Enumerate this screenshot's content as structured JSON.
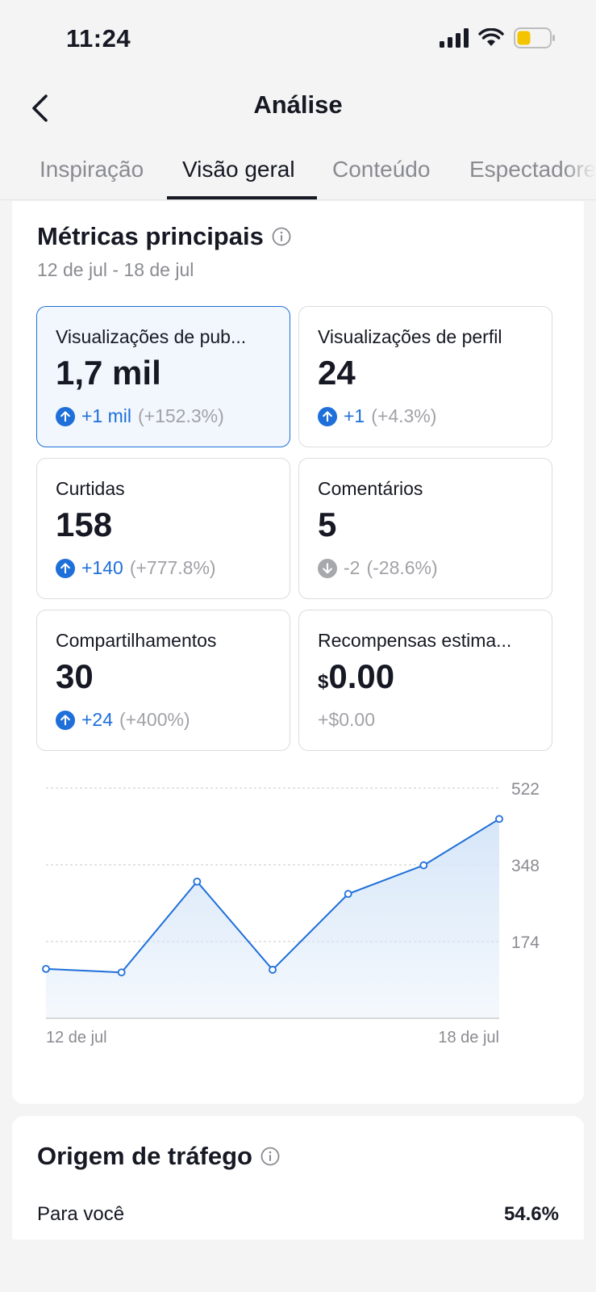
{
  "status_bar": {
    "time": "11:24",
    "icons": [
      "cellular-signal-icon",
      "wifi-icon",
      "battery-low-icon"
    ]
  },
  "header": {
    "title": "Análise",
    "back_icon": "chevron-left-icon"
  },
  "tabs": [
    {
      "label": "Inspiração",
      "active": false
    },
    {
      "label": "Visão geral",
      "active": true
    },
    {
      "label": "Conteúdo",
      "active": false
    },
    {
      "label": "Espectadores",
      "active": false
    }
  ],
  "metrics_section": {
    "title": "Métricas principais",
    "date_range": "12 de jul - 18 de jul",
    "cards": [
      {
        "label": "Visualizações de pub...",
        "value": "1,7 mil",
        "change_abs": "+1 mil",
        "change_pct": "(+152.3%)",
        "trend": "up",
        "selected": true
      },
      {
        "label": "Visualizações de perfil",
        "value": "24",
        "change_abs": "+1",
        "change_pct": "(+4.3%)",
        "trend": "up",
        "selected": false
      },
      {
        "label": "Curtidas",
        "value": "158",
        "change_abs": "+140",
        "change_pct": "(+777.8%)",
        "trend": "up",
        "selected": false
      },
      {
        "label": "Comentários",
        "value": "5",
        "change_abs": "-2",
        "change_pct": "(-28.6%)",
        "trend": "down",
        "selected": false
      },
      {
        "label": "Compartilhamentos",
        "value": "30",
        "change_abs": "+24",
        "change_pct": "(+400%)",
        "trend": "up",
        "selected": false
      },
      {
        "label": "Recompensas estima...",
        "currency": "$",
        "value": "0.00",
        "change_abs": "+$0.00",
        "change_pct": "",
        "trend": "none",
        "selected": false
      }
    ]
  },
  "chart_data": {
    "type": "area",
    "x": [
      "12 de jul",
      "13 de jul",
      "14 de jul",
      "15 de jul",
      "16 de jul",
      "17 de jul",
      "18 de jul"
    ],
    "x_tick_labels": [
      "12 de jul",
      "18 de jul"
    ],
    "values": [
      112,
      104,
      310,
      110,
      282,
      347,
      452
    ],
    "y_ticks": [
      174,
      348,
      522
    ],
    "ylim": [
      0,
      522
    ],
    "grid": true,
    "y_axis_side": "right",
    "line_color": "#1e6fd9",
    "fill_color": "#d6e6f8"
  },
  "traffic_section": {
    "title": "Origem de tráfego",
    "rows": [
      {
        "label": "Para você",
        "value": "54.6%"
      }
    ]
  },
  "colors": {
    "accent": "#1e6fd9",
    "muted": "#a1a2a7",
    "text": "#161823"
  }
}
